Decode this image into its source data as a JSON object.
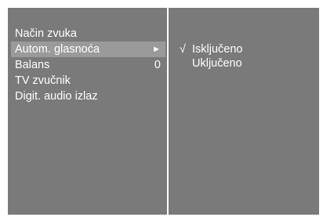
{
  "menu": {
    "items": [
      {
        "label": "Način zvuka",
        "value": ""
      },
      {
        "label": "Autom. glasnoća",
        "value": "►",
        "selected": true
      },
      {
        "label": "Balans",
        "value": "0"
      },
      {
        "label": "TV zvučnik",
        "value": ""
      },
      {
        "label": "Digit. audio izlaz",
        "value": ""
      }
    ]
  },
  "submenu": {
    "check_mark": "√",
    "options": [
      {
        "label": "Isključeno",
        "checked": true
      },
      {
        "label": "Uključeno",
        "checked": false
      }
    ]
  },
  "colors": {
    "panel": "#7a7a7a",
    "highlight": "#9a9a9a",
    "text": "#ffffff",
    "frame": "#ffffff"
  }
}
